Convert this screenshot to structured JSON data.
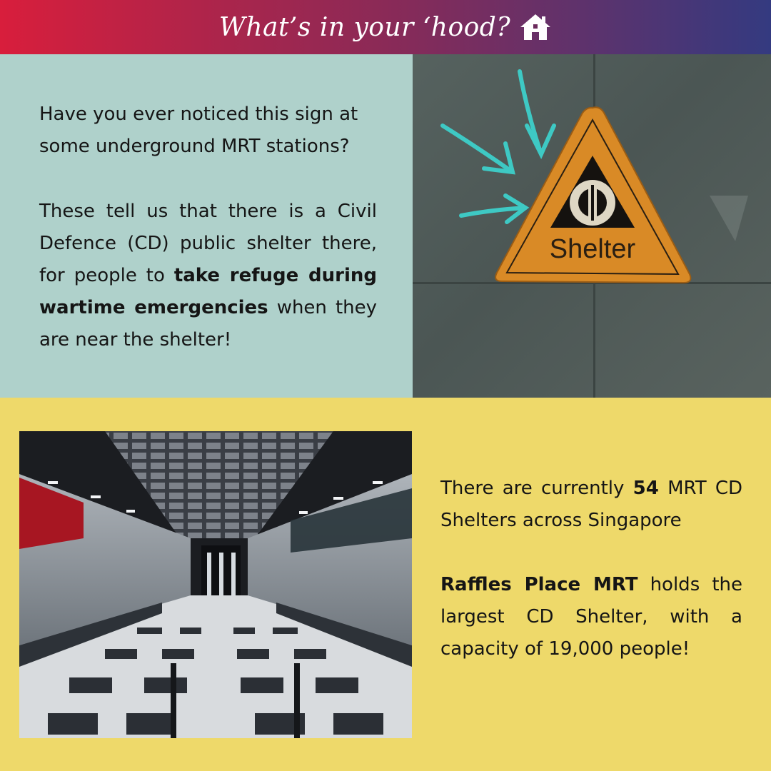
{
  "header": {
    "title": "What’s in your ‘hood?",
    "icon": "home-icon"
  },
  "top_panel": {
    "p1": "Have you ever noticed this sign at some underground MRT stations?",
    "p2_a": "These tell us that there is a Civil Defence (CD) public shelter there, for people to ",
    "p2_bold": "take refuge during wartime emergencies",
    "p2_b": " when they are near the shelter!"
  },
  "sign_photo": {
    "sign_text": "Shelter",
    "symbol_icon": "civil-defence-logo-icon",
    "arrow_color": "#3ec9c4",
    "sign_color": "#d98a26"
  },
  "bottom_panel": {
    "p3_a": "There are currently ",
    "p3_bold": "54",
    "p3_b": " MRT CD Shelters across Singapore",
    "p4_bold": "Raffles Place MRT",
    "p4_a": " holds the largest CD Shelter, with a capacity of 19,000 people!"
  },
  "colors": {
    "header_gradient": [
      "#d81e3c",
      "#343a80"
    ],
    "mint_panel": "#afd1cb",
    "yellow_panel": "#eed96a"
  }
}
